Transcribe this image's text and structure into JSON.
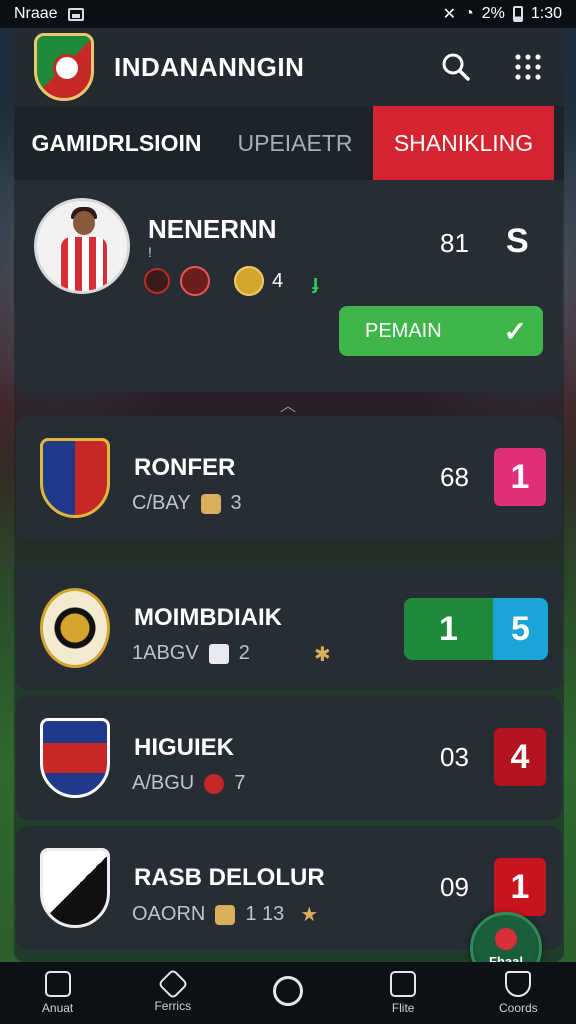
{
  "status_bar": {
    "carrier": "Nraae",
    "battery_text": "2%",
    "time": "1:30"
  },
  "app": {
    "title": "INDANANNGIN",
    "search_icon": "search-icon",
    "grid_icon": "grid-menu-icon"
  },
  "tabs": [
    {
      "label": "GAMIDRLSIOIN",
      "active": false
    },
    {
      "label": "UPEIAETR",
      "active": false
    },
    {
      "label": "SHANIKLING",
      "active": true
    }
  ],
  "player": {
    "name": "NENERNN",
    "sub": "!",
    "badge_count": "4",
    "flash": "ɟ",
    "score_a": "81",
    "score_b": "S",
    "button_label": "PEMAIN"
  },
  "clubs": [
    {
      "name": "RONFER",
      "meta": "C/BAY",
      "meta_value": "3",
      "score": "68",
      "badge": "1",
      "badge_color": "#e0307a",
      "crest_colors": [
        "#1f3a8a",
        "#c62828",
        "#e0b83a"
      ]
    },
    {
      "name": "MOIMBDIAIK",
      "meta": "1ABGV",
      "meta_value": "2",
      "extra": "✱",
      "badge_left": "1",
      "badge_right": "5",
      "badge_left_color": "#1f8a3a",
      "badge_right_color": "#1aa5d6",
      "crest_colors": [
        "#f3ead2",
        "#111111",
        "#d4a62d"
      ]
    },
    {
      "name": "HIGUIEK",
      "meta": "A/BGU",
      "meta_value": "7",
      "score": "03",
      "badge": "4",
      "badge_color": "#b3141f",
      "crest_colors": [
        "#1f3a8a",
        "#c62828",
        "#ffffff"
      ]
    },
    {
      "name": "RASB DELOLUR",
      "meta": "OAORN",
      "meta_value": "1 13",
      "extra": "★",
      "score": "09",
      "badge": "1",
      "badge_color": "#c8141f",
      "crest_colors": [
        "#ffffff",
        "#111111",
        "#c62828"
      ]
    }
  ],
  "fab": {
    "label": "Fhaal"
  },
  "bottom_nav": [
    {
      "label": "Anuat",
      "icon": "home-icon"
    },
    {
      "label": "Ferrics",
      "icon": "pen-icon"
    },
    {
      "label": "",
      "icon": "circle-icon"
    },
    {
      "label": "Flite",
      "icon": "check-square-icon"
    },
    {
      "label": "Coords",
      "icon": "shield-icon"
    }
  ]
}
